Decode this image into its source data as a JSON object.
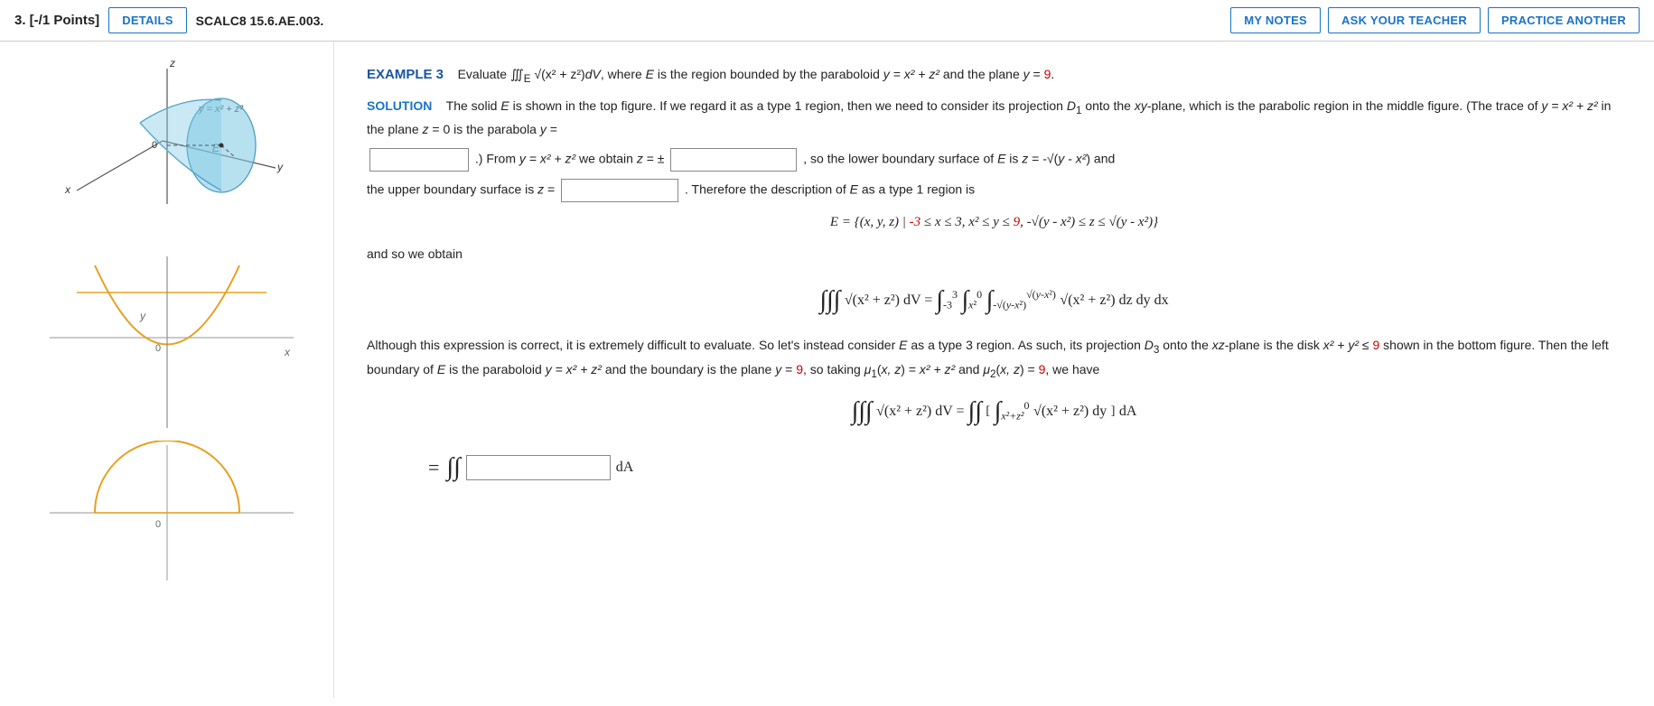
{
  "header": {
    "problem_number": "3.  [-/1 Points]",
    "details_label": "DETAILS",
    "problem_code": "SCALC8 15.6.AE.003.",
    "my_notes_label": "MY NOTES",
    "ask_teacher_label": "ASK YOUR TEACHER",
    "practice_another_label": "PRACTICE ANOTHER"
  },
  "example": {
    "label": "EXAMPLE 3",
    "description": "Evaluate ∭E √(x² + z²)dV, where E is the region bounded by the paraboloid y = x² + z² and the plane y =",
    "red_value_1": "9",
    "solution_label": "SOLUTION",
    "solution_text_1": "The solid E is shown in the top figure. If we regard it as a type 1 region, then we need to consider its projection D₁ onto the xy-plane, which is the parabolic region in the middle figure. (The trace of y = x² + z² in the plane z = 0 is the parabola y =",
    "input1_placeholder": "",
    "solution_text_2": ".) From y = x² + z² we obtain z = ±",
    "input2_placeholder": "",
    "solution_text_3": ", so the lower boundary surface of E is z = -√(y - x²) and the upper boundary surface is z =",
    "input3_placeholder": "",
    "solution_text_4": ". Therefore the description of E as a type 1 region is",
    "set_def": "E = {(x, y, z) | -3 ≤ x ≤ 3, x² ≤ y ≤ 9, -√(y - x²) ≤ z ≤ √(y - x²)}",
    "set_def_red": "-3",
    "set_def_red2": "9",
    "and_so": "and so we obtain",
    "integral_text": "Although this expression is correct, it is extremely difficult to evaluate. So let's instead consider E as a type 3 region. As such, its projection D₃ onto the xz-plane is the disk x² + y² ≤",
    "red_value_2": "9",
    "integral_text2": "shown in the bottom figure. Then the left boundary of E is the paraboloid y = x² + z² and the boundary is the plane y =",
    "red_value_3": "9",
    "integral_text3": ", so taking μ₁(x, z) = x² + z² and μ₂(x, z) =",
    "red_value_4": "9",
    "integral_text4": ", we have",
    "bottom_label": "= ∬"
  }
}
